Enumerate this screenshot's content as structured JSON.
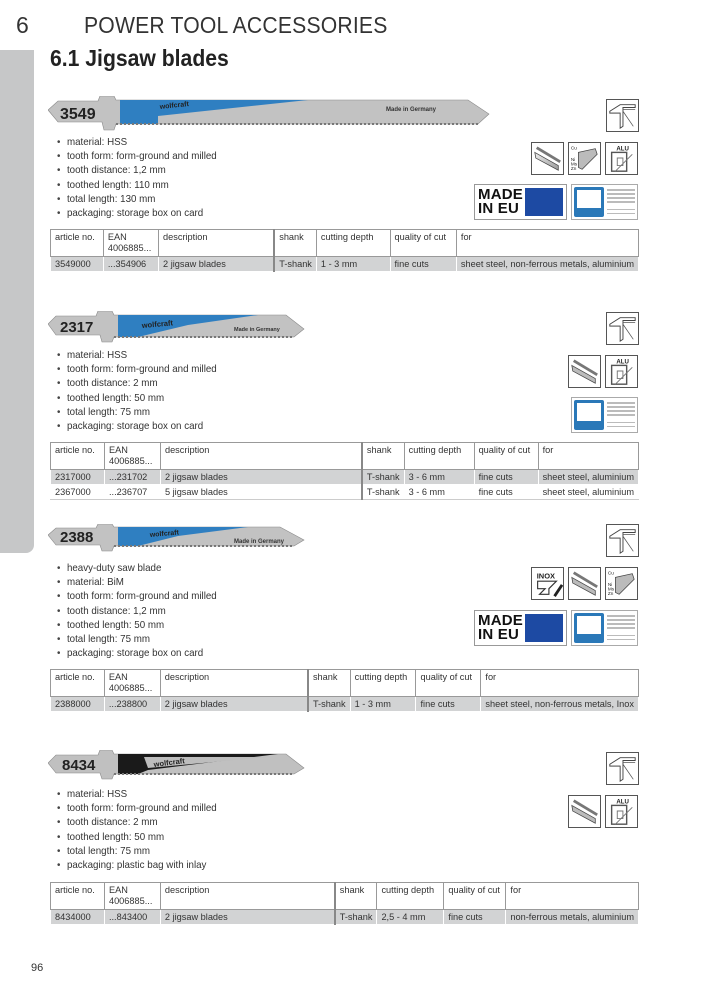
{
  "header": {
    "chapter_number": "6",
    "chapter_title": "POWER TOOL ACCESSORIES",
    "section_title": "6.1 Jigsaw blades"
  },
  "table_headers": [
    "article no.",
    "EAN\n4006885...",
    "description",
    "shank",
    "cutting depth",
    "quality of cut",
    "for"
  ],
  "products": [
    {
      "blade_number": "3549",
      "brand": "wolfcraft",
      "made_in": "Made in Germany",
      "blade_accent_color": "#2f7fc1",
      "features": [
        "material: HSS",
        "tooth form: form-ground and milled",
        "tooth distance: 1,2 mm",
        "toothed length: 110 mm",
        "total length: 130 mm",
        "packaging: storage box on card"
      ],
      "icons": [
        "fine-cut-icon",
        "sheet-metal-icon",
        "non-ferrous-metal-icon",
        "aluminium-icon",
        "made-in-eu-badge",
        "tuv-certified-badge"
      ],
      "badge_labels": {
        "cu": "Cu",
        "ni": "Ni",
        "ms": "Ms",
        "zn": "Zn",
        "alu": "ALU",
        "made": "MADE",
        "in_eu": "IN EU"
      },
      "rows": [
        [
          "3549000",
          "...354906",
          "2 jigsaw blades",
          "T-shank",
          "1 - 3 mm",
          "fine cuts",
          "sheet steel, non-ferrous metals, aluminium"
        ]
      ]
    },
    {
      "blade_number": "2317",
      "brand": "wolfcraft",
      "made_in": "Made in Germany",
      "blade_accent_color": "#2f7fc1",
      "features": [
        "material: HSS",
        "tooth form: form-ground and milled",
        "tooth distance: 2 mm",
        "toothed length: 50 mm",
        "total length: 75 mm",
        "packaging: storage box on card"
      ],
      "icons": [
        "fine-cut-icon",
        "sheet-metal-icon",
        "aluminium-icon",
        "tuv-certified-badge"
      ],
      "badge_labels": {
        "alu": "ALU"
      },
      "rows": [
        [
          "2317000",
          "...231702",
          "2 jigsaw blades",
          "T-shank",
          "3 - 6 mm",
          "fine cuts",
          "sheet steel, aluminium"
        ],
        [
          "2367000",
          "...236707",
          "5 jigsaw blades",
          "T-shank",
          "3 - 6 mm",
          "fine cuts",
          "sheet steel, aluminium"
        ]
      ]
    },
    {
      "blade_number": "2388",
      "brand": "wolfcraft",
      "made_in": "Made in Germany",
      "blade_accent_color": "#2f7fc1",
      "features": [
        "heavy-duty saw blade",
        "material: BiM",
        "tooth form: form-ground and milled",
        "tooth distance: 1,2 mm",
        "toothed length: 50 mm",
        "total length: 75 mm",
        "packaging: storage box on card"
      ],
      "icons": [
        "fine-cut-icon",
        "inox-icon",
        "sheet-metal-icon",
        "non-ferrous-metal-icon",
        "made-in-eu-badge",
        "tuv-certified-badge"
      ],
      "badge_labels": {
        "inox": "INOX",
        "cu": "Cu",
        "ni": "Ni",
        "ms": "Ms",
        "zn": "Zn",
        "made": "MADE",
        "in_eu": "IN EU"
      },
      "rows": [
        [
          "2388000",
          "...238800",
          "2 jigsaw blades",
          "T-shank",
          "1 - 3 mm",
          "fine cuts",
          "sheet steel, non-ferrous metals, Inox"
        ]
      ]
    },
    {
      "blade_number": "8434",
      "brand": "wolfcraft",
      "made_in": "",
      "blade_accent_color": "#1a1a1a",
      "features": [
        "material: HSS",
        "tooth form: form-ground and milled",
        "tooth distance: 2 mm",
        "toothed length: 50 mm",
        "total length: 75 mm",
        "packaging: plastic bag with inlay"
      ],
      "icons": [
        "fine-cut-icon",
        "sheet-metal-icon",
        "aluminium-icon"
      ],
      "badge_labels": {
        "alu": "ALU"
      },
      "rows": [
        [
          "8434000",
          "...843400",
          "2 jigsaw blades",
          "T-shank",
          "2,5 - 4 mm",
          "fine cuts",
          "non-ferrous metals, aluminium"
        ]
      ]
    }
  ],
  "footer": {
    "page_number": "96"
  }
}
